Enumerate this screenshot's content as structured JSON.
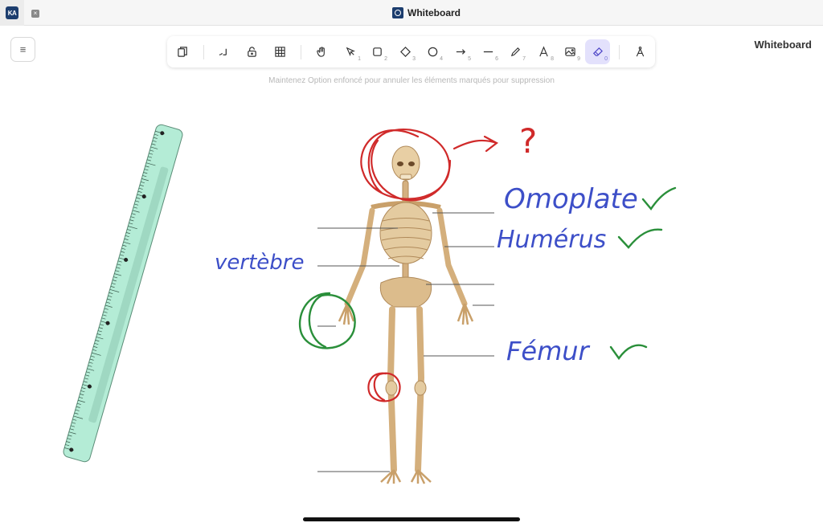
{
  "window": {
    "title": "Whiteboard",
    "tab_logo": "KA",
    "tab_close_icon": "×"
  },
  "menu": {
    "icon": "≡"
  },
  "toolbar": {
    "tools": [
      {
        "name": "library",
        "icon": "library-icon",
        "key": ""
      },
      {
        "name": "scribble",
        "icon": "scribble-icon",
        "key": ""
      },
      {
        "name": "lock",
        "icon": "unlock-icon",
        "key": ""
      },
      {
        "name": "grid",
        "icon": "grid-icon",
        "key": ""
      },
      {
        "name": "hand",
        "icon": "hand-icon",
        "key": ""
      },
      {
        "name": "selection",
        "icon": "pointer-icon",
        "key": "1"
      },
      {
        "name": "rectangle",
        "icon": "rectangle-icon",
        "key": "2"
      },
      {
        "name": "diamond",
        "icon": "diamond-icon",
        "key": "3"
      },
      {
        "name": "ellipse",
        "icon": "ellipse-icon",
        "key": "4"
      },
      {
        "name": "arrow",
        "icon": "arrow-icon",
        "key": "5"
      },
      {
        "name": "line",
        "icon": "line-icon",
        "key": "6"
      },
      {
        "name": "draw",
        "icon": "pencil-icon",
        "key": "7"
      },
      {
        "name": "text",
        "icon": "text-icon",
        "key": "8"
      },
      {
        "name": "image",
        "icon": "image-icon",
        "key": "9"
      },
      {
        "name": "eraser",
        "icon": "eraser-icon",
        "key": "0",
        "active": true
      },
      {
        "name": "extra-tools",
        "icon": "compass-icon",
        "key": ""
      }
    ]
  },
  "hint": "Maintenez Option enfoncé pour annuler les éléments marqués pour suppression",
  "page_label": "Whiteboard",
  "annotations": {
    "question_mark": "?",
    "labels": [
      "Omoplate",
      "Humérus",
      "vertèbre",
      "Fémur"
    ],
    "checkmarks": 3
  },
  "colors": {
    "accent": "#4d45c7",
    "active_tool_bg": "#e3e1fc",
    "ink_blue": "#3d4fc8",
    "ink_red": "#d02a2a",
    "ink_green": "#2a8f3a",
    "ruler": "#a8e6cf"
  }
}
